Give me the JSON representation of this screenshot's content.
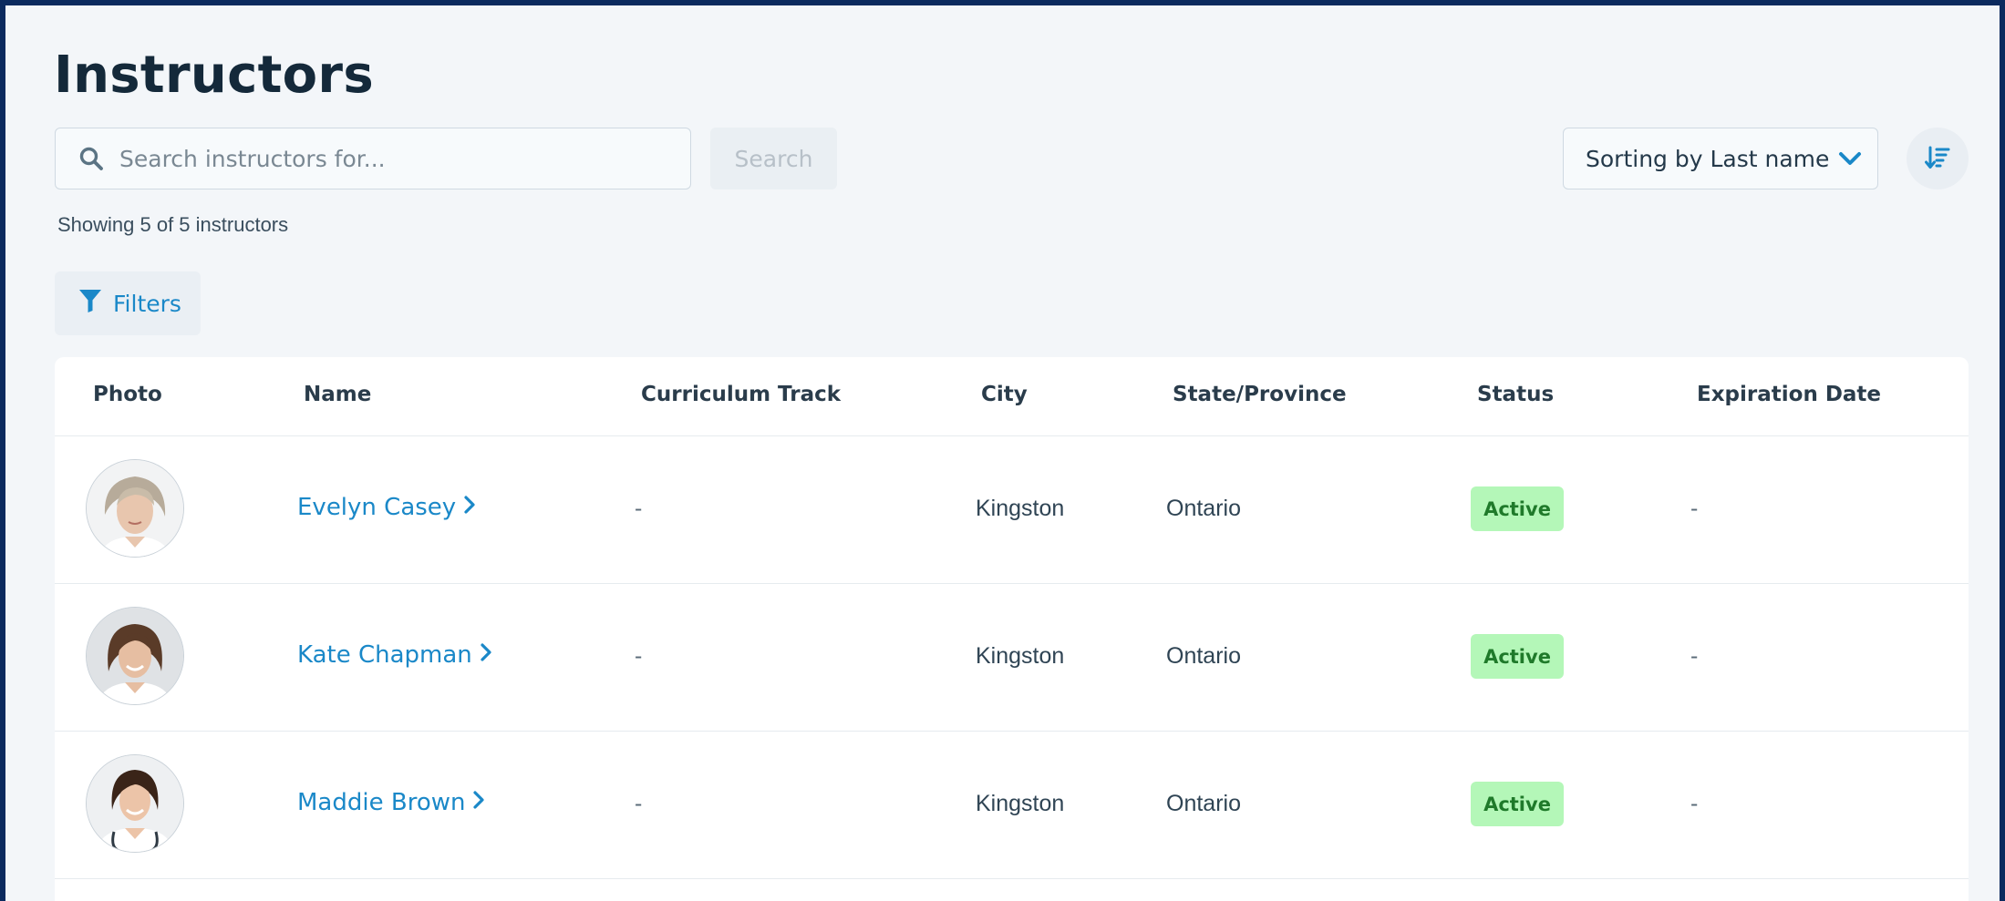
{
  "page": {
    "title": "Instructors"
  },
  "search": {
    "placeholder": "Search instructors for...",
    "value": "",
    "button_label": "Search",
    "icon": "search-icon"
  },
  "results": {
    "showing_text": "Showing 5 of 5 instructors"
  },
  "filters": {
    "label": "Filters",
    "icon": "filter-icon"
  },
  "sort": {
    "label": "Sorting by Last name",
    "icon": "chevron-down-icon",
    "order_icon": "sort-descending-icon"
  },
  "table": {
    "columns": [
      "Photo",
      "Name",
      "Curriculum Track",
      "City",
      "State/Province",
      "Status",
      "Expiration Date"
    ],
    "rows": [
      {
        "name": "Evelyn Casey",
        "curriculum_track": "-",
        "city": "Kingston",
        "state": "Ontario",
        "status": "Active",
        "expiration": "-"
      },
      {
        "name": "Kate Chapman",
        "curriculum_track": "-",
        "city": "Kingston",
        "state": "Ontario",
        "status": "Active",
        "expiration": "-"
      },
      {
        "name": "Maddie Brown",
        "curriculum_track": "-",
        "city": "Kingston",
        "state": "Ontario",
        "status": "Active",
        "expiration": "-"
      }
    ]
  },
  "colors": {
    "frame_border": "#0b2a5e",
    "background": "#f3f6f9",
    "accent": "#1a88c8",
    "title": "#14293a",
    "status_active_bg": "#b4f7b8",
    "status_active_text": "#1f7a2a"
  }
}
